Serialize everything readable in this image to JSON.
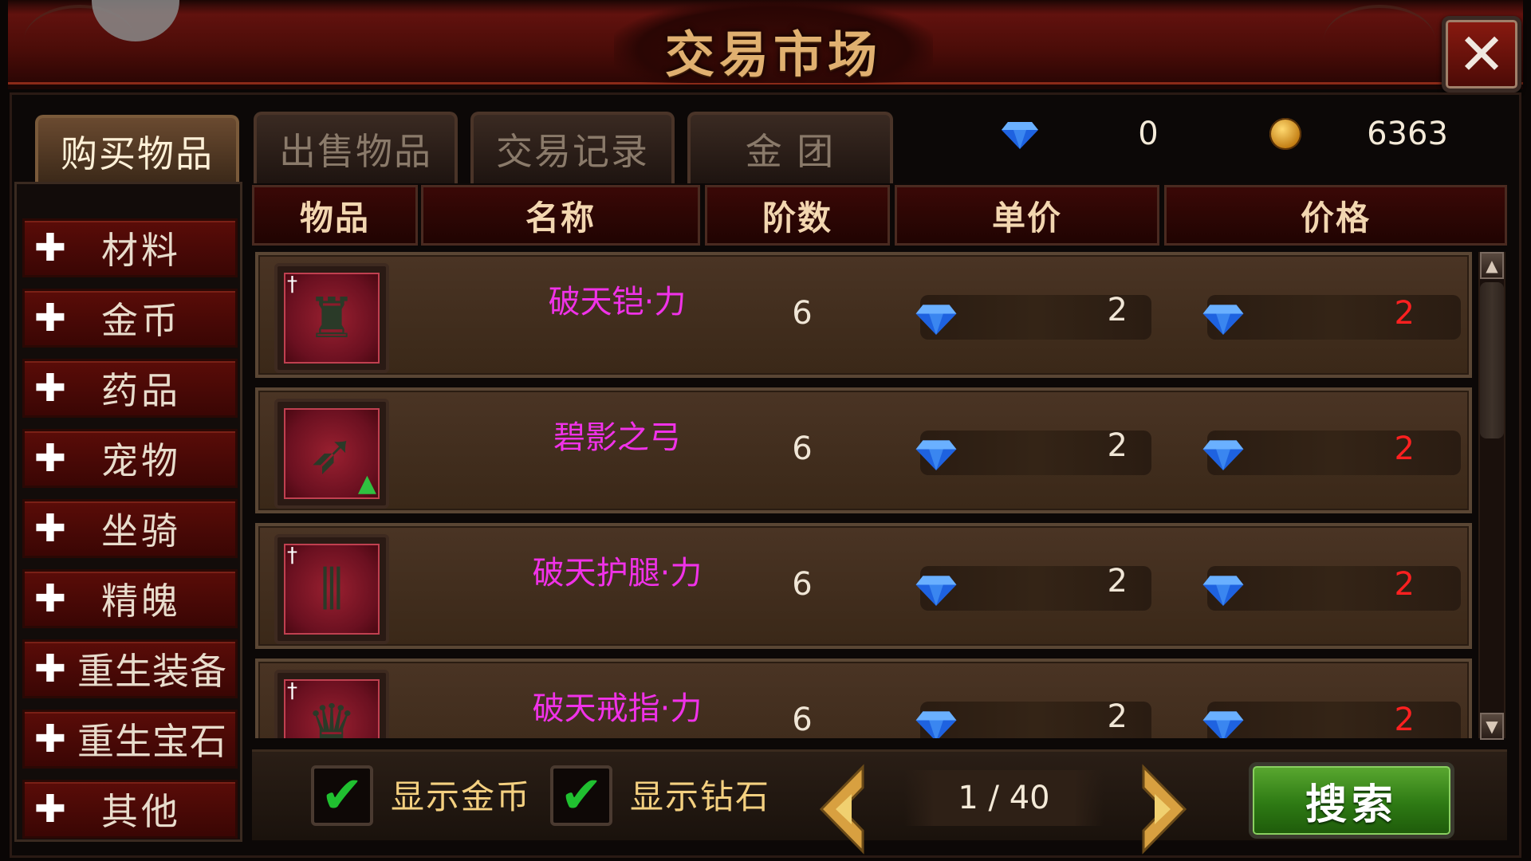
{
  "window": {
    "title": "交易市场"
  },
  "tabs": [
    {
      "label": "购买物品",
      "active": true
    },
    {
      "label": "出售物品",
      "active": false
    },
    {
      "label": "交易记录",
      "active": false
    },
    {
      "label": "金 团",
      "active": false
    }
  ],
  "currency": {
    "diamonds": "0",
    "gold": "6363"
  },
  "sidebar": {
    "items": [
      {
        "label": "材料"
      },
      {
        "label": "金币"
      },
      {
        "label": "药品"
      },
      {
        "label": "宠物"
      },
      {
        "label": "坐骑"
      },
      {
        "label": "精魄"
      },
      {
        "label": "重生装备"
      },
      {
        "label": "重生宝石"
      },
      {
        "label": "其他"
      }
    ]
  },
  "table": {
    "headers": [
      "物品",
      "名称",
      "阶数",
      "单价",
      "价格"
    ],
    "rows": [
      {
        "name": "破天铠·力",
        "tier": "6",
        "unit_price": "2",
        "price": "2",
        "icon": "armor-icon"
      },
      {
        "name": "碧影之弓",
        "tier": "6",
        "unit_price": "2",
        "price": "2",
        "icon": "bow-icon"
      },
      {
        "name": "破天护腿·力",
        "tier": "6",
        "unit_price": "2",
        "price": "2",
        "icon": "leggings-icon"
      },
      {
        "name": "破天戒指·力",
        "tier": "6",
        "unit_price": "2",
        "price": "2",
        "icon": "ring-icon"
      }
    ]
  },
  "filters": {
    "show_gold_label": "显示金币",
    "show_gold_checked": true,
    "show_diamond_label": "显示钻石",
    "show_diamond_checked": true
  },
  "pager": {
    "text": "1 / 40"
  },
  "search": {
    "label": "搜索"
  },
  "colors": {
    "item_name": "#f032e8",
    "price_value": "#ff2020",
    "unit_price_value": "#f0e6d6"
  }
}
